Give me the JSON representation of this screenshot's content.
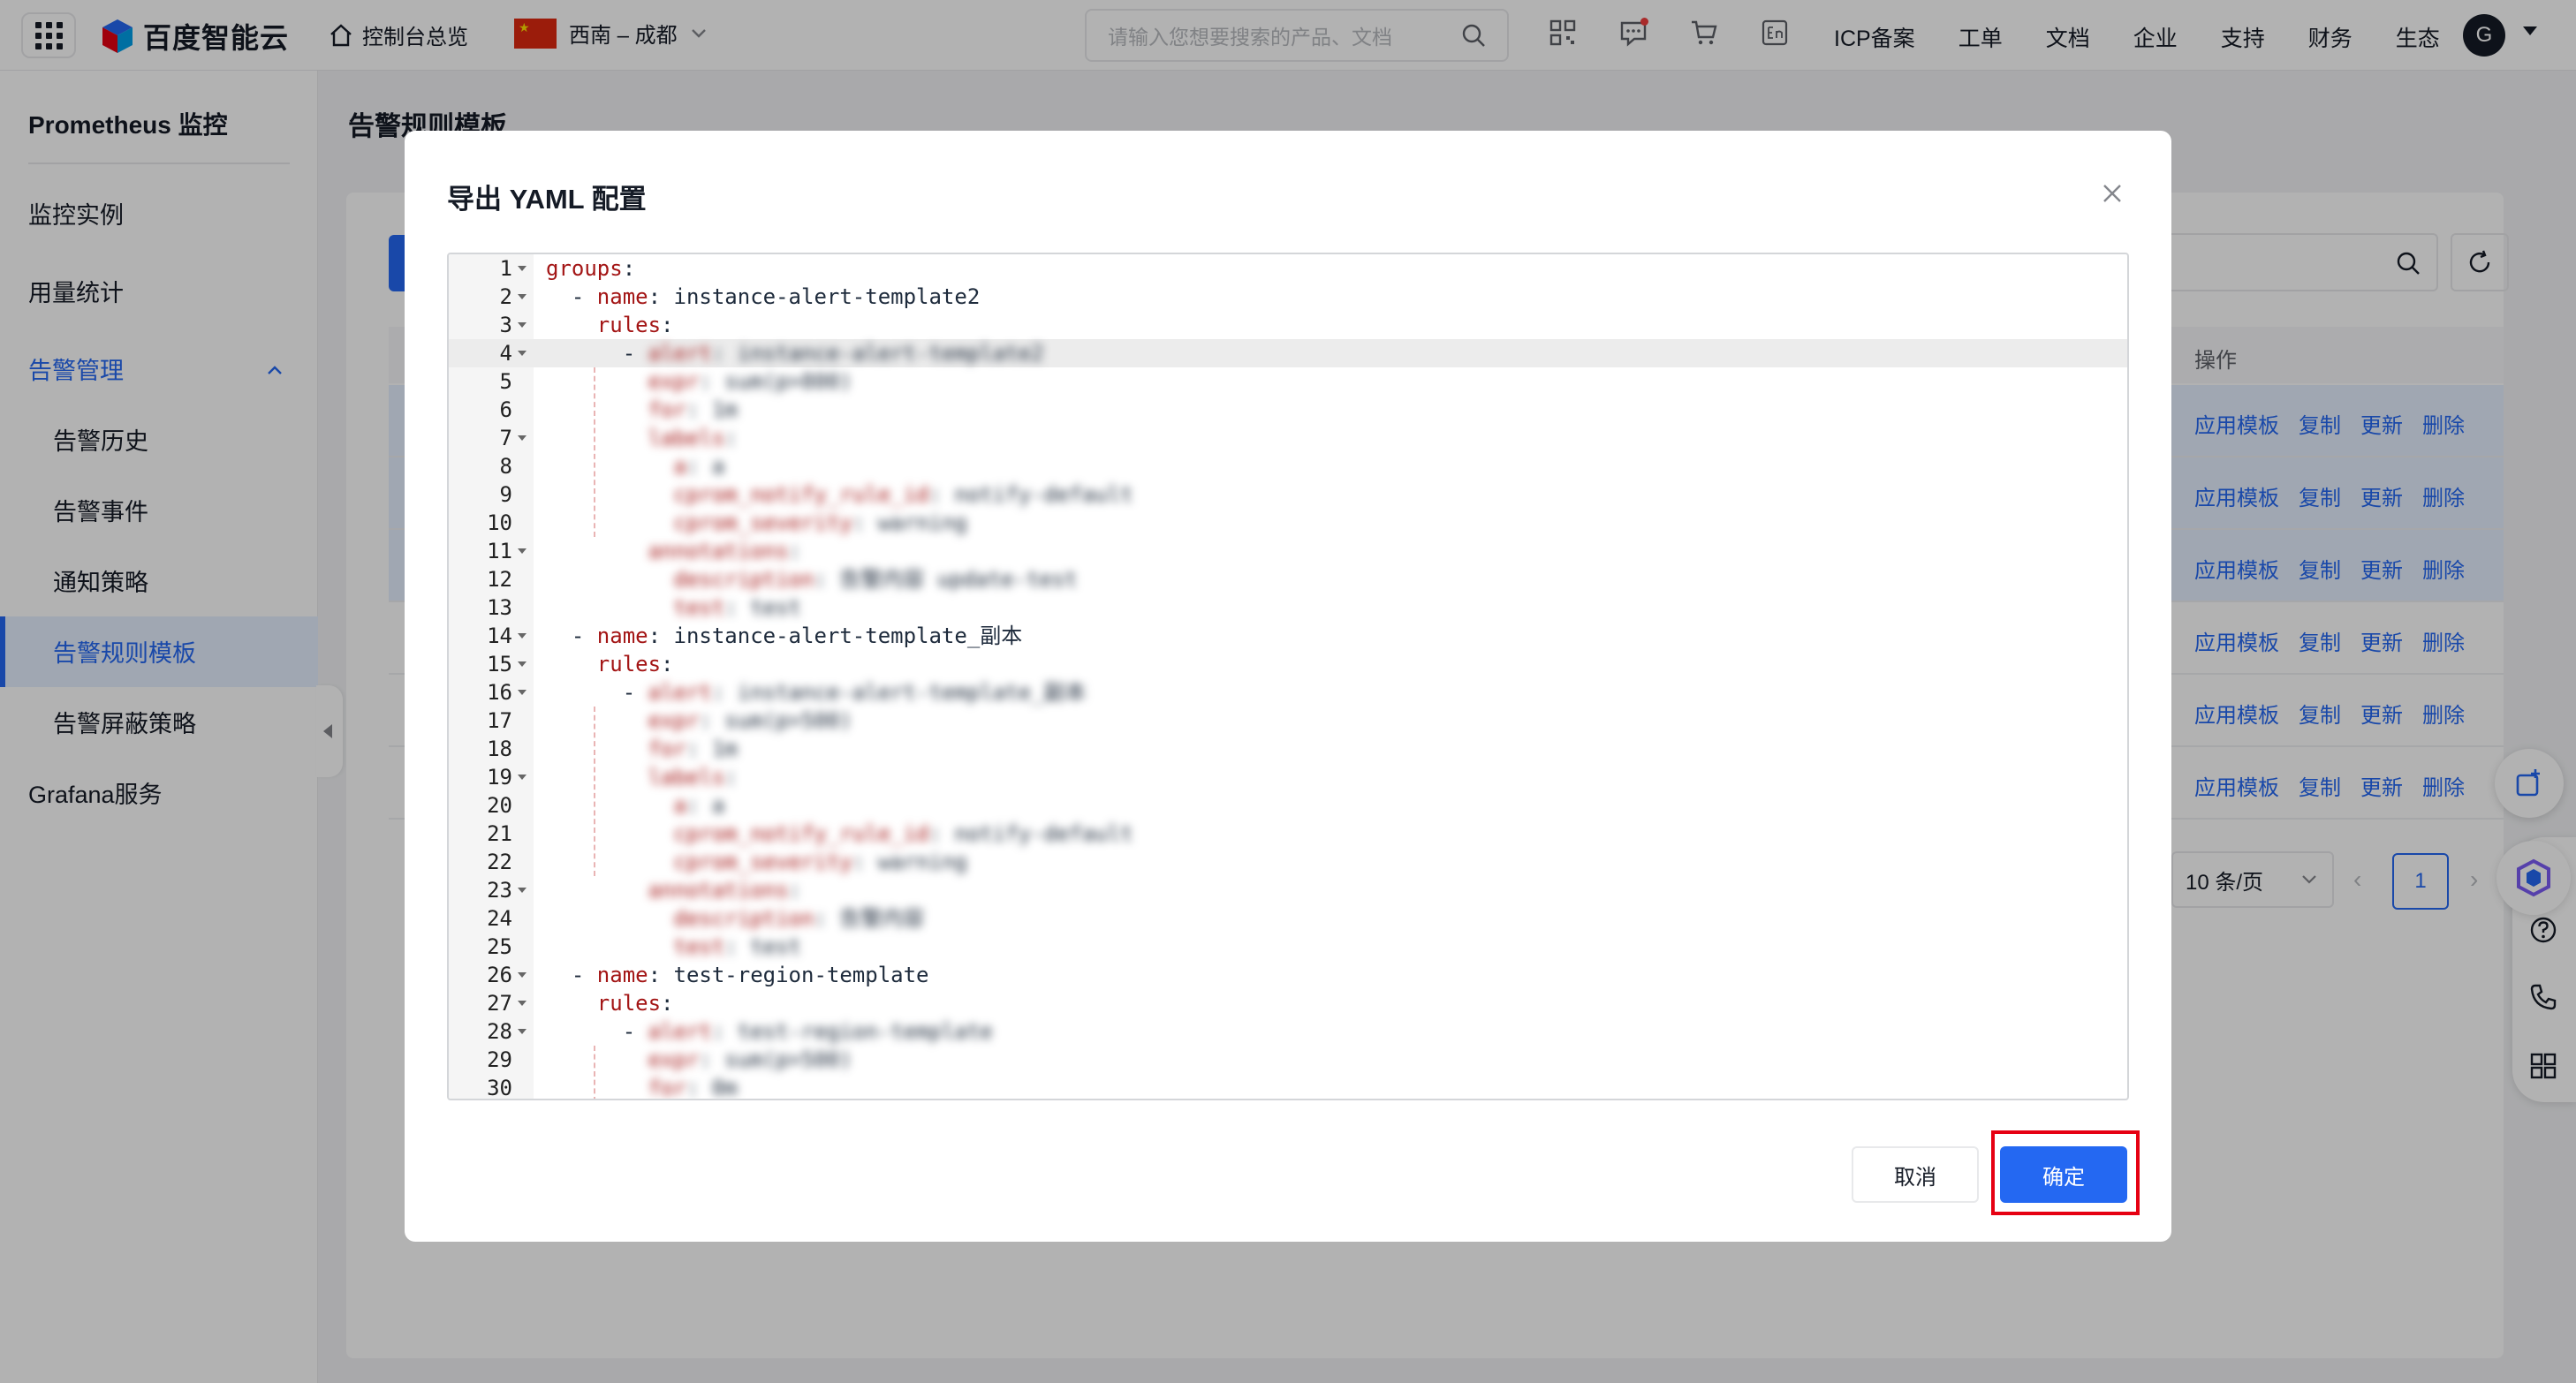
{
  "topnav": {
    "brand": "百度智能云",
    "console": "控制台总览",
    "region": "西南 – 成都",
    "search_placeholder": "请输入您想要搜索的产品、文档",
    "links": [
      "ICP备案",
      "工单",
      "文档",
      "企业",
      "支持",
      "财务",
      "生态"
    ],
    "avatar_letter": "G"
  },
  "sidebar": {
    "title": "Prometheus 监控",
    "items": {
      "instances": "监控实例",
      "usage": "用量统计",
      "alert_mgmt": "告警管理",
      "alert_history": "告警历史",
      "alert_events": "告警事件",
      "notify_policy": "通知策略",
      "alert_rule_tpl": "告警规则模板",
      "alert_mute": "告警屏蔽策略",
      "grafana": "Grafana服务"
    }
  },
  "page": {
    "title": "告警规则模板",
    "col_ops": "操作",
    "row_ops": [
      "应用模板",
      "复制",
      "更新",
      "删除"
    ],
    "row_count": 6,
    "page_size": "10 条/页",
    "current_page": "1"
  },
  "modal": {
    "title": "导出 YAML 配置",
    "cancel": "取消",
    "confirm": "确定",
    "lines": [
      {
        "n": "1",
        "fold": true,
        "indent": "",
        "key": "groups",
        "sep": ":",
        "val": "",
        "blur": false
      },
      {
        "n": "2",
        "fold": true,
        "indent": "  - ",
        "key": "name",
        "sep": ": ",
        "val": "instance-alert-template2",
        "blur": false
      },
      {
        "n": "3",
        "fold": true,
        "indent": "    ",
        "key": "rules",
        "sep": ":",
        "val": "",
        "blur": false
      },
      {
        "n": "4",
        "fold": true,
        "indent": "      - ",
        "key": "alert",
        "sep": ": ",
        "val": "instance-alert-template2",
        "blur": true
      },
      {
        "n": "5",
        "fold": false,
        "indent": "        ",
        "key": "expr",
        "sep": ": ",
        "val": "sum(p>800)",
        "blur": true
      },
      {
        "n": "6",
        "fold": false,
        "indent": "        ",
        "key": "for",
        "sep": ": ",
        "val": "1m",
        "blur": true
      },
      {
        "n": "7",
        "fold": true,
        "indent": "        ",
        "key": "labels",
        "sep": ":",
        "val": "",
        "blur": true
      },
      {
        "n": "8",
        "fold": false,
        "indent": "          ",
        "key": "a",
        "sep": ": ",
        "val": "a",
        "blur": true
      },
      {
        "n": "9",
        "fold": false,
        "indent": "          ",
        "key": "cprom_notify_rule_id",
        "sep": ": ",
        "val": "notify-default",
        "blur": true
      },
      {
        "n": "10",
        "fold": false,
        "indent": "          ",
        "key": "cprom_severity",
        "sep": ": ",
        "val": "warning",
        "blur": true
      },
      {
        "n": "11",
        "fold": true,
        "indent": "        ",
        "key": "annotations",
        "sep": ":",
        "val": "",
        "blur": true
      },
      {
        "n": "12",
        "fold": false,
        "indent": "          ",
        "key": "description",
        "sep": ": ",
        "val": "告警内容 update-test",
        "blur": true
      },
      {
        "n": "13",
        "fold": false,
        "indent": "          ",
        "key": "test",
        "sep": ": ",
        "val": "test",
        "blur": true
      },
      {
        "n": "14",
        "fold": true,
        "indent": "  - ",
        "key": "name",
        "sep": ": ",
        "val": "instance-alert-template_副本",
        "blur": false
      },
      {
        "n": "15",
        "fold": true,
        "indent": "    ",
        "key": "rules",
        "sep": ":",
        "val": "",
        "blur": false
      },
      {
        "n": "16",
        "fold": true,
        "indent": "      - ",
        "key": "alert",
        "sep": ": ",
        "val": "instance-alert-template_副本",
        "blur": true
      },
      {
        "n": "17",
        "fold": false,
        "indent": "        ",
        "key": "expr",
        "sep": ": ",
        "val": "sum(p>500)",
        "blur": true
      },
      {
        "n": "18",
        "fold": false,
        "indent": "        ",
        "key": "for",
        "sep": ": ",
        "val": "1m",
        "blur": true
      },
      {
        "n": "19",
        "fold": true,
        "indent": "        ",
        "key": "labels",
        "sep": ":",
        "val": "",
        "blur": true
      },
      {
        "n": "20",
        "fold": false,
        "indent": "          ",
        "key": "a",
        "sep": ": ",
        "val": "a",
        "blur": true
      },
      {
        "n": "21",
        "fold": false,
        "indent": "          ",
        "key": "cprom_notify_rule_id",
        "sep": ": ",
        "val": "notify-default",
        "blur": true
      },
      {
        "n": "22",
        "fold": false,
        "indent": "          ",
        "key": "cprom_severity",
        "sep": ": ",
        "val": "warning",
        "blur": true
      },
      {
        "n": "23",
        "fold": true,
        "indent": "        ",
        "key": "annotations",
        "sep": ":",
        "val": "",
        "blur": true
      },
      {
        "n": "24",
        "fold": false,
        "indent": "          ",
        "key": "description",
        "sep": ": ",
        "val": "告警内容",
        "blur": true
      },
      {
        "n": "25",
        "fold": false,
        "indent": "          ",
        "key": "test",
        "sep": ": ",
        "val": "test",
        "blur": true
      },
      {
        "n": "26",
        "fold": true,
        "indent": "  - ",
        "key": "name",
        "sep": ": ",
        "val": "test-region-template",
        "blur": false
      },
      {
        "n": "27",
        "fold": true,
        "indent": "    ",
        "key": "rules",
        "sep": ":",
        "val": "",
        "blur": false
      },
      {
        "n": "28",
        "fold": true,
        "indent": "      - ",
        "key": "alert",
        "sep": ": ",
        "val": "test-region-template",
        "blur": true
      },
      {
        "n": "29",
        "fold": false,
        "indent": "        ",
        "key": "expr",
        "sep": ": ",
        "val": "sum(p>500)",
        "blur": true
      },
      {
        "n": "30",
        "fold": false,
        "indent": "        ",
        "key": "for",
        "sep": ": ",
        "val": "0m",
        "blur": true
      }
    ]
  },
  "colors": {
    "accent": "#2468f2",
    "yaml_key": "#a31515",
    "highlight_box": "#e60012"
  }
}
